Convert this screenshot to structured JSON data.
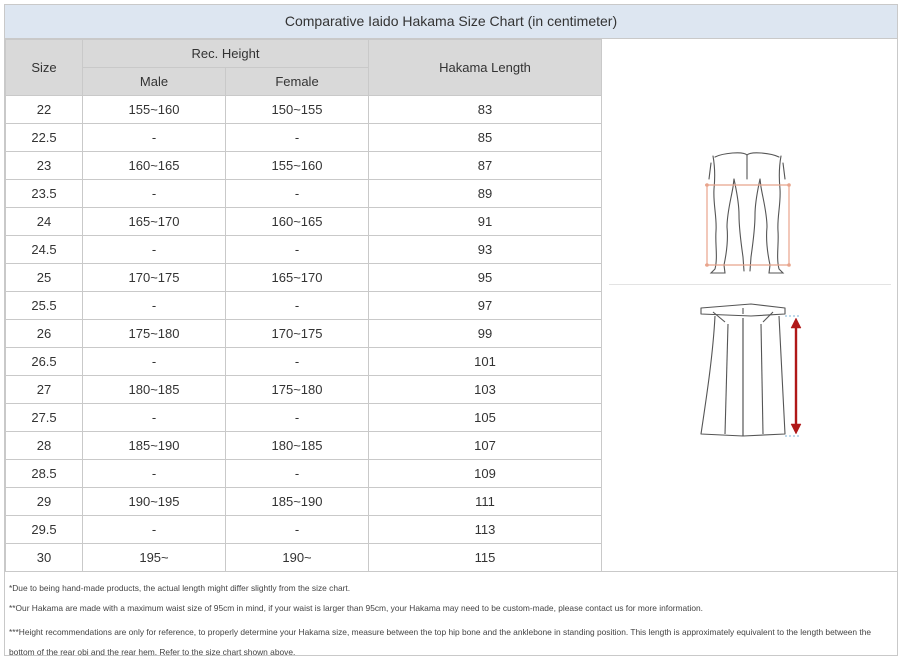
{
  "title": "Comparative Iaido Hakama Size Chart (in centimeter)",
  "headers": {
    "size": "Size",
    "rec_height": "Rec. Height",
    "male": "Male",
    "female": "Female",
    "hakama_length": "Hakama Length"
  },
  "rows": [
    {
      "size": "22",
      "male": "155~160",
      "female": "150~155",
      "length": "83"
    },
    {
      "size": "22.5",
      "male": "-",
      "female": "-",
      "length": "85"
    },
    {
      "size": "23",
      "male": "160~165",
      "female": "155~160",
      "length": "87"
    },
    {
      "size": "23.5",
      "male": "-",
      "female": "-",
      "length": "89"
    },
    {
      "size": "24",
      "male": "165~170",
      "female": "160~165",
      "length": "91"
    },
    {
      "size": "24.5",
      "male": "-",
      "female": "-",
      "length": "93"
    },
    {
      "size": "25",
      "male": "170~175",
      "female": "165~170",
      "length": "95"
    },
    {
      "size": "25.5",
      "male": "-",
      "female": "-",
      "length": "97"
    },
    {
      "size": "26",
      "male": "175~180",
      "female": "170~175",
      "length": "99"
    },
    {
      "size": "26.5",
      "male": "-",
      "female": "-",
      "length": "101"
    },
    {
      "size": "27",
      "male": "180~185",
      "female": "175~180",
      "length": "103"
    },
    {
      "size": "27.5",
      "male": "-",
      "female": "-",
      "length": "105"
    },
    {
      "size": "28",
      "male": "185~190",
      "female": "180~185",
      "length": "107"
    },
    {
      "size": "28.5",
      "male": "-",
      "female": "-",
      "length": "109"
    },
    {
      "size": "29",
      "male": "190~195",
      "female": "185~190",
      "length": "111"
    },
    {
      "size": "29.5",
      "male": "-",
      "female": "-",
      "length": "113"
    },
    {
      "size": "30",
      "male": "195~",
      "female": "190~",
      "length": "115"
    }
  ],
  "notes": [
    "*Due to being hand-made products, the actual length might differ slightly from the size chart.",
    "**Our Hakama are made with a maximum waist size of 95cm in mind, if your waist is larger than 95cm, your Hakama may need to be custom-made, please contact us for more information.",
    "***Height recommendations are only for reference, to properly determine your Hakama size, measure between the top hip bone and the anklebone in standing position. This length is approximately equivalent to the length between the bottom of the rear obi and the rear hem. Refer to the size chart shown above."
  ],
  "colors": {
    "title_bg": "#dde6f1",
    "header_bg": "#d9d9d9",
    "border": "#c9c9c9",
    "body_measure_line": "#e8a48c",
    "hakama_arrow": "#b01818"
  },
  "icons": {
    "legs_figure": "legs-measurement-icon",
    "hakama_figure": "hakama-measurement-icon"
  }
}
